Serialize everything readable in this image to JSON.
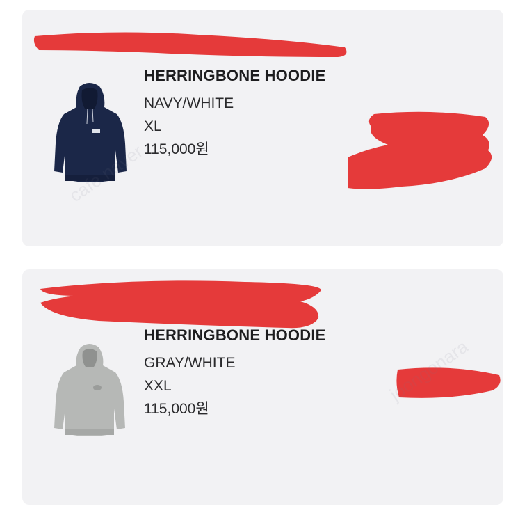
{
  "orders": [
    {
      "name": "HERRINGBONE HOODIE",
      "color": "NAVY/WHITE",
      "size": "XL",
      "price": "115,000원",
      "image_color": "#1b2748"
    },
    {
      "name": "HERRINGBONE HOODIE",
      "color": "GRAY/WHITE",
      "size": "XXL",
      "price": "115,000원",
      "image_color": "#b6b8b6"
    }
  ],
  "colors": {
    "card_background": "#f2f2f4",
    "text": "#1d1d1f",
    "redaction": "#e53a3a"
  }
}
